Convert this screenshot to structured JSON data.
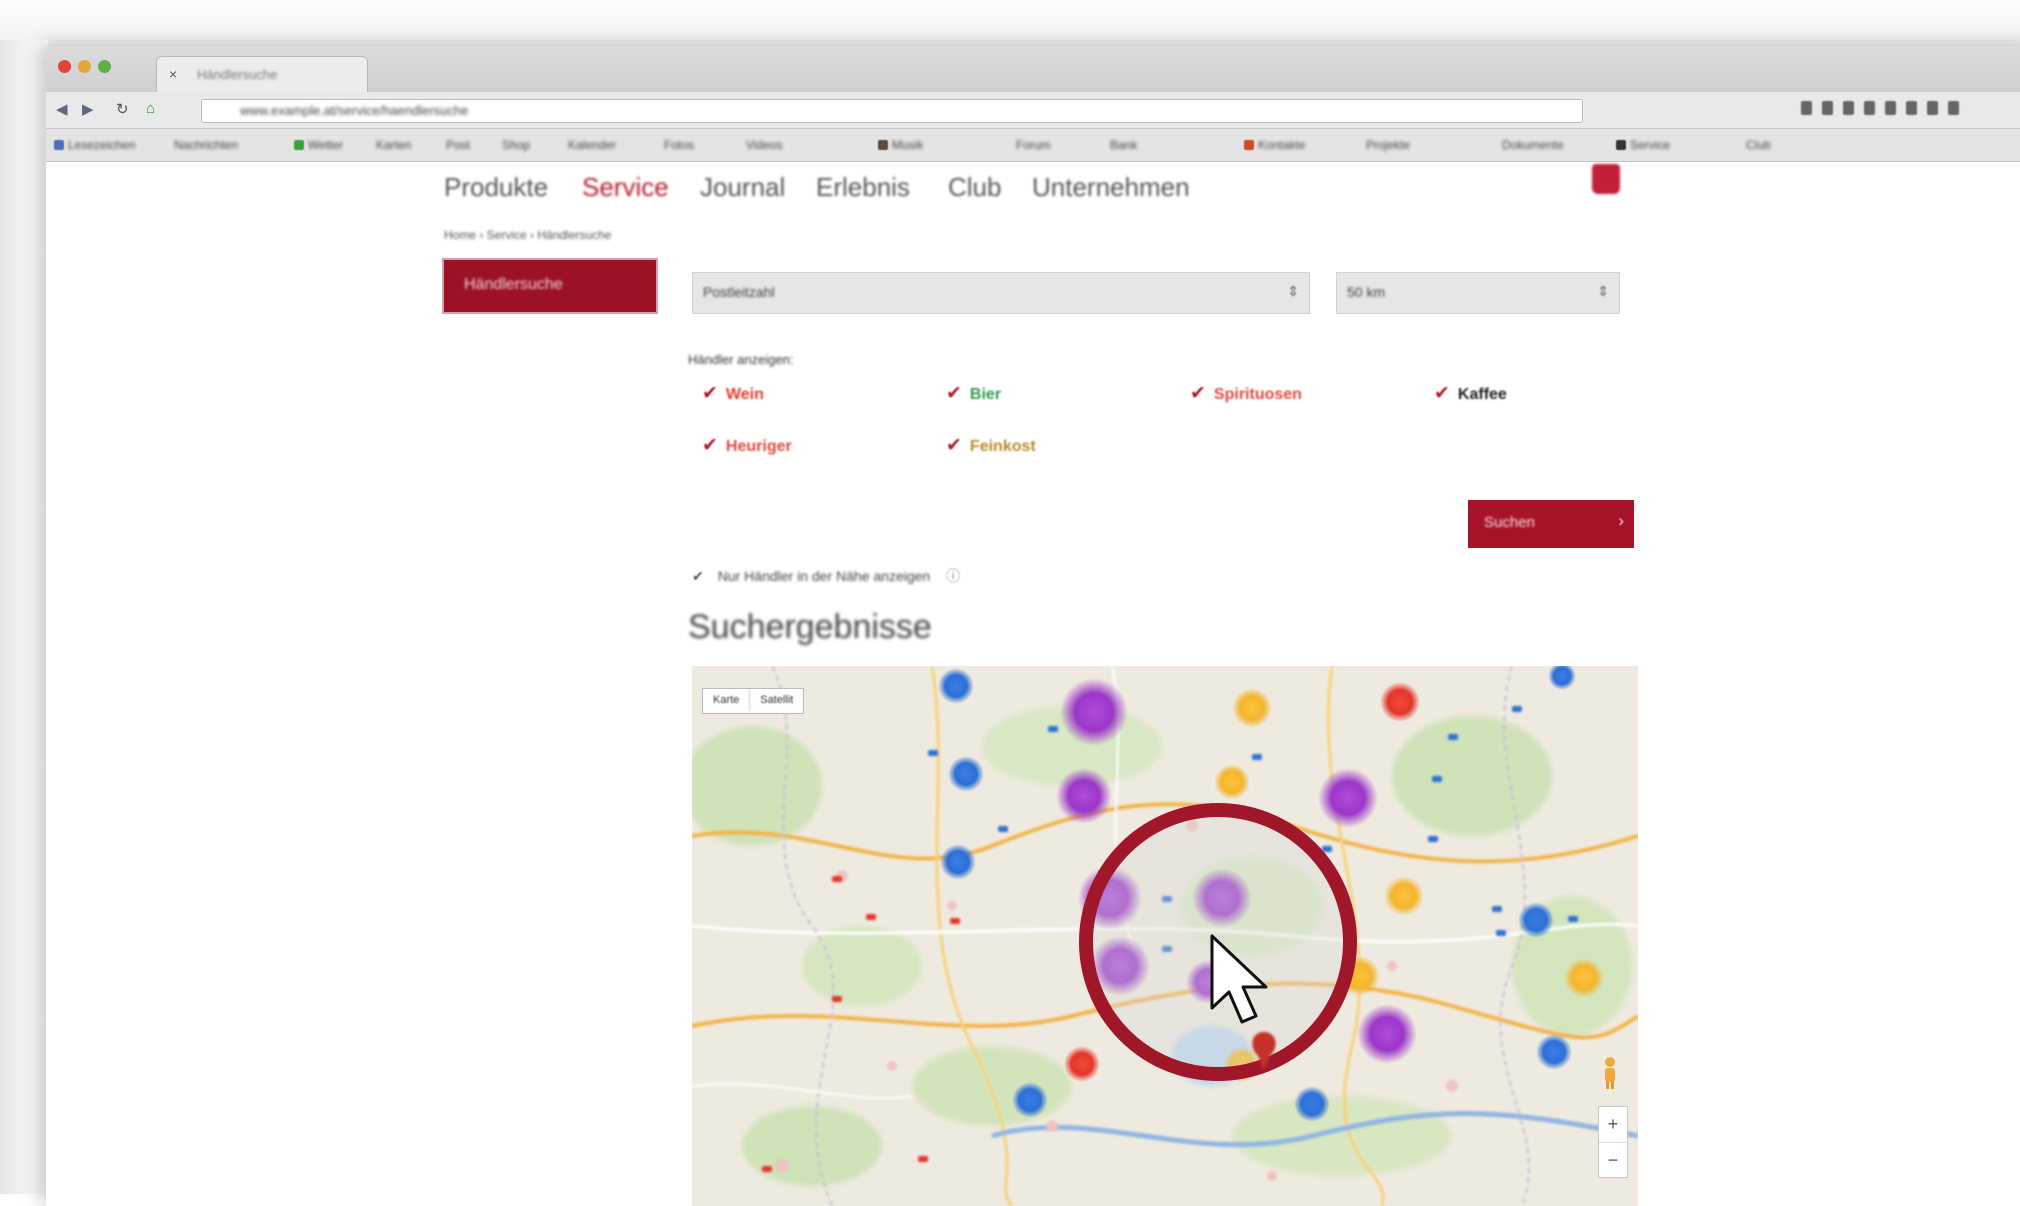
{
  "browser": {
    "tab_title": "Händlersuche",
    "url": "www.example.at/service/haendlersuche",
    "tab_close_icon": "×",
    "nav": {
      "back": "◀",
      "forward": "▶",
      "reload": "↻",
      "home": "⌂"
    },
    "bookmarks": [
      "Lesezeichen",
      "Nachrichten",
      "Wetter",
      "Karten",
      "Post",
      "Shop",
      "Kalender",
      "Fotos",
      "Videos",
      "Musik",
      "Forum",
      "Bank",
      "Kontakte",
      "Projekte",
      "Dokumente",
      "Service",
      "Club"
    ]
  },
  "site": {
    "nav_items": [
      "Produkte",
      "Service",
      "Journal",
      "Erlebnis",
      "Club",
      "Unternehmen"
    ],
    "active_nav": "Service",
    "breadcrumb": "Home › Service › Händlersuche",
    "sidebar_button": "Händlersuche",
    "select_location": {
      "value": "Postleitzahl",
      "arrow": "⇕"
    },
    "select_radius": {
      "value": "50 km",
      "arrow": "⇕"
    },
    "filter_label": "Händler anzeigen:",
    "categories": [
      {
        "label": "Wein",
        "color": "#e03c2c"
      },
      {
        "label": "Bier",
        "color": "#2f9b4a"
      },
      {
        "label": "Spirituosen",
        "color": "#e04a3e"
      },
      {
        "label": "Kaffee",
        "color": "#222222"
      },
      {
        "label": "Heuriger",
        "color": "#e04a3e"
      },
      {
        "label": "Feinkost",
        "color": "#b88a2c"
      }
    ],
    "checkmark": "✔",
    "search_button": "Suchen",
    "search_button_icon": "›",
    "visible_checkbox": "✔",
    "visible_text": "Nur Händler in der Nähe anzeigen",
    "visible_icon": "ⓘ",
    "results_title": "Suchergebnisse",
    "map": {
      "type_options": [
        "Karte",
        "Satellit"
      ],
      "zoom_in": "+",
      "zoom_out": "−",
      "colors": {
        "purple": "#9b37c9",
        "blue": "#2e6fd6",
        "yellow": "#f3b52f",
        "red": "#e3362b"
      }
    }
  },
  "colors": {
    "brand": "#a8132a",
    "highlight_ring": "#a1172a"
  }
}
